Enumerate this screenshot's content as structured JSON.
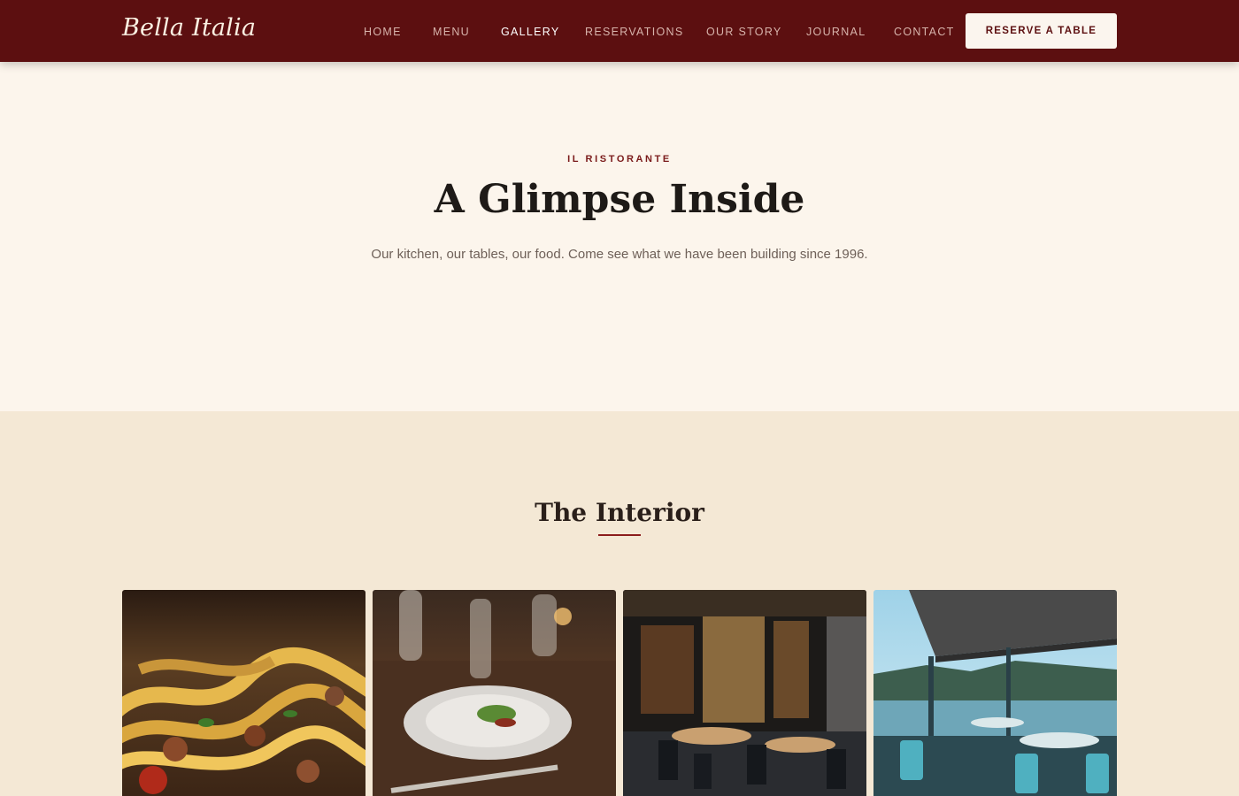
{
  "header": {
    "brand": "Bella Italia",
    "nav": [
      {
        "label": "HOME",
        "active": false
      },
      {
        "label": "MENU",
        "active": false
      },
      {
        "label": "GALLERY",
        "active": true
      },
      {
        "label": "RESERVATIONS",
        "active": false
      },
      {
        "label": "OUR STORY",
        "active": false
      },
      {
        "label": "JOURNAL",
        "active": false
      },
      {
        "label": "CONTACT",
        "active": false
      }
    ],
    "cta": "RESERVE A TABLE"
  },
  "hero": {
    "eyebrow": "IL RISTORANTE",
    "title": "A Glimpse Inside",
    "subtitle": "Our kitchen, our tables, our food. Come see what we have been building since 1996."
  },
  "interior": {
    "title": "The Interior",
    "photos": [
      {
        "subject": "pasta-dish-photo"
      },
      {
        "subject": "plated-table-photo"
      },
      {
        "subject": "dining-room-photo"
      },
      {
        "subject": "waterfront-terrace-photo"
      }
    ]
  },
  "colors": {
    "header_bg": "#5c0f10",
    "accent": "#8b1c1c",
    "hero_bg": "#fcf5ec",
    "section_bg": "#f4e8d5"
  }
}
